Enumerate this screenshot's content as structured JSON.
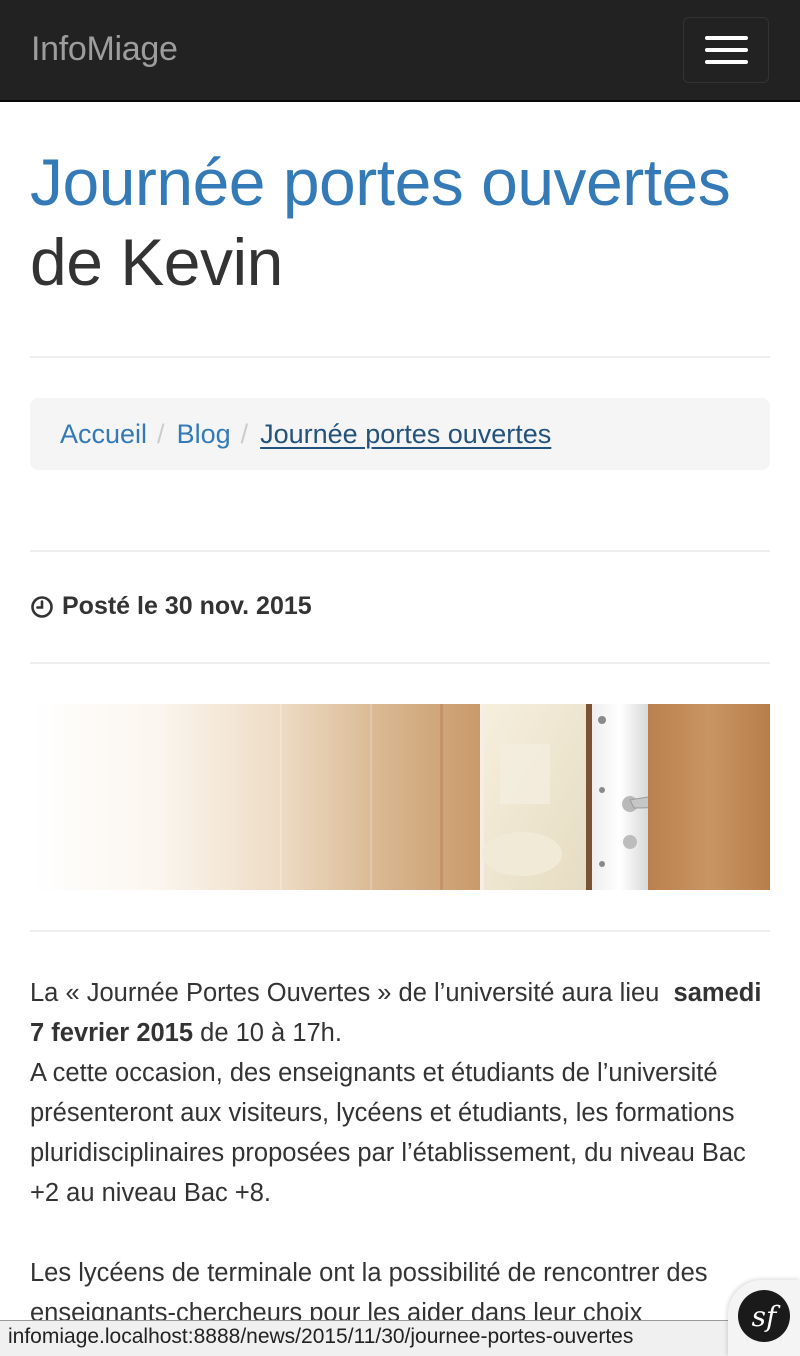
{
  "navbar": {
    "brand": "InfoMiage",
    "toggle_icon": "hamburger-menu-icon"
  },
  "title": {
    "accent": "Journée portes ouvertes",
    "rest": "de Kevin"
  },
  "breadcrumb": {
    "items": [
      "Accueil",
      "Blog"
    ],
    "separator": "/",
    "current": "Journée portes ouvertes"
  },
  "meta": {
    "icon": "clock-icon",
    "posted": "Posté le 30 nov. 2015"
  },
  "hero": {
    "alt": "open-door-image"
  },
  "article": {
    "p1_start": "La « Journée Portes Ouvertes » de l’université aura lieu",
    "p1_bold": "samedi 7 fevrier 2015",
    "p1_end": "de 10 à 17h.",
    "p1_line2": "A cette occasion, des enseignants et étudiants de l’université présenteront aux visiteurs, lycéens et étudiants, les formations pluridisciplinaires proposées par l’établissement, du niveau Bac +2 au niveau Bac +8.",
    "p2": "Les lycéens de terminale ont la possibilité de rencontrer des enseignants-chercheurs pour les aider dans leur choix"
  },
  "statusbar": {
    "url": "infomiage.localhost:8888/news/2015/11/30/journee-portes-ouvertes"
  },
  "debug_toolbar": {
    "icon": "symfony-icon",
    "label": "sf"
  },
  "colors": {
    "navbar_bg": "#222222",
    "link": "#337ab7",
    "link_active": "#23527c",
    "text": "#333333"
  }
}
